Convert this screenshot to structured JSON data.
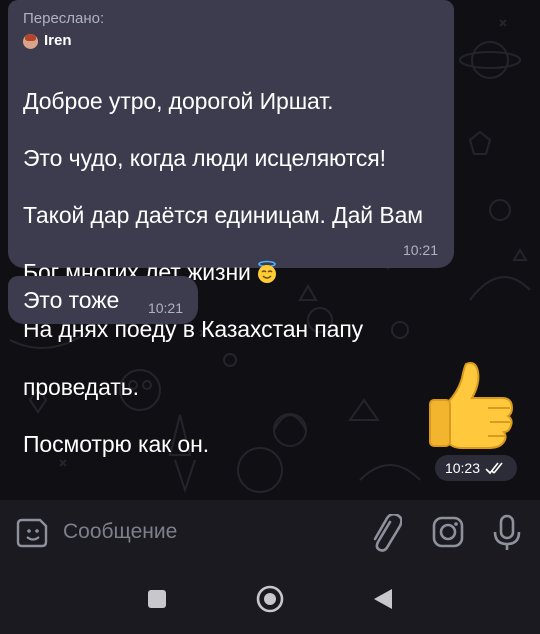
{
  "messages": [
    {
      "forwarded_label": "Переслано:",
      "forwarded_from": "Iren",
      "text_lines": [
        "Доброе утро, дорогой Иршат.",
        "Это чудо, когда люди исцеляются!",
        "Такой дар даётся единицам. Дай Вам",
        "Бог многих лет жизни",
        "На днях поеду в Казахстан папу",
        "проведать.",
        "Посмотрю как он."
      ],
      "emoji": "smiling-face-with-halo",
      "time": "10:21"
    },
    {
      "text": "Это тоже",
      "time": "10:21"
    }
  ],
  "outgoing": {
    "sticker": "thumbs-up",
    "time": "10:23",
    "status": "read"
  },
  "input": {
    "placeholder": "Сообщение"
  },
  "icons": {
    "emoji": "sticker-emoji-icon",
    "attach": "paperclip-icon",
    "camera": "camera-icon",
    "mic": "microphone-icon"
  },
  "colors": {
    "incoming_bubble": "#3c3c4e",
    "background": "#101014",
    "input_bar": "#1a1a20",
    "secondary_text": "#aeb2c2"
  }
}
